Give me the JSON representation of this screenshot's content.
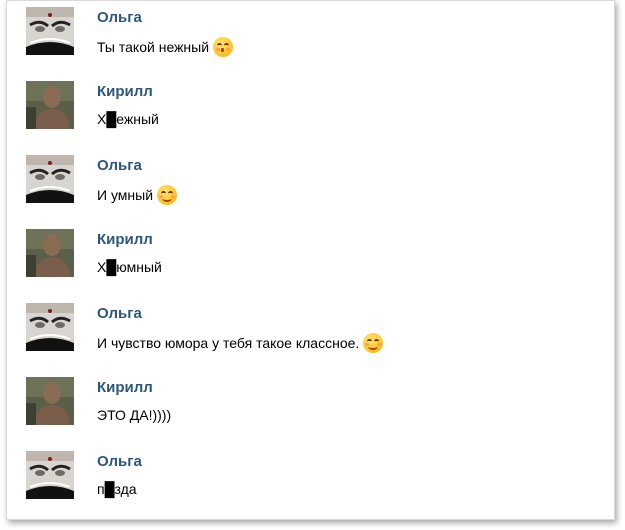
{
  "messages": [
    {
      "author": "Ольга",
      "avatar": "woman-face-avatar",
      "text": "Ты такой нежный",
      "emoji": "kissing-face-icon"
    },
    {
      "author": "Кирилл",
      "avatar": "man-photo-avatar",
      "text": "Х█ежный",
      "emoji": null
    },
    {
      "author": "Ольга",
      "avatar": "woman-face-avatar",
      "text": "И умный",
      "emoji": "smiling-face-icon"
    },
    {
      "author": "Кирилл",
      "avatar": "man-photo-avatar",
      "text": "Х█юмный",
      "emoji": null
    },
    {
      "author": "Ольга",
      "avatar": "woman-face-avatar",
      "text": "И чувство юмора у тебя такое классное.",
      "emoji": "smiling-face-icon"
    },
    {
      "author": "Кирилл",
      "avatar": "man-photo-avatar",
      "text": "ЭТО ДА!))))",
      "emoji": null
    },
    {
      "author": "Ольга",
      "avatar": "woman-face-avatar",
      "text": "п█зда",
      "emoji": null
    }
  ],
  "colors": {
    "name": "#2b587a",
    "text": "#000000",
    "background": "#ffffff"
  }
}
